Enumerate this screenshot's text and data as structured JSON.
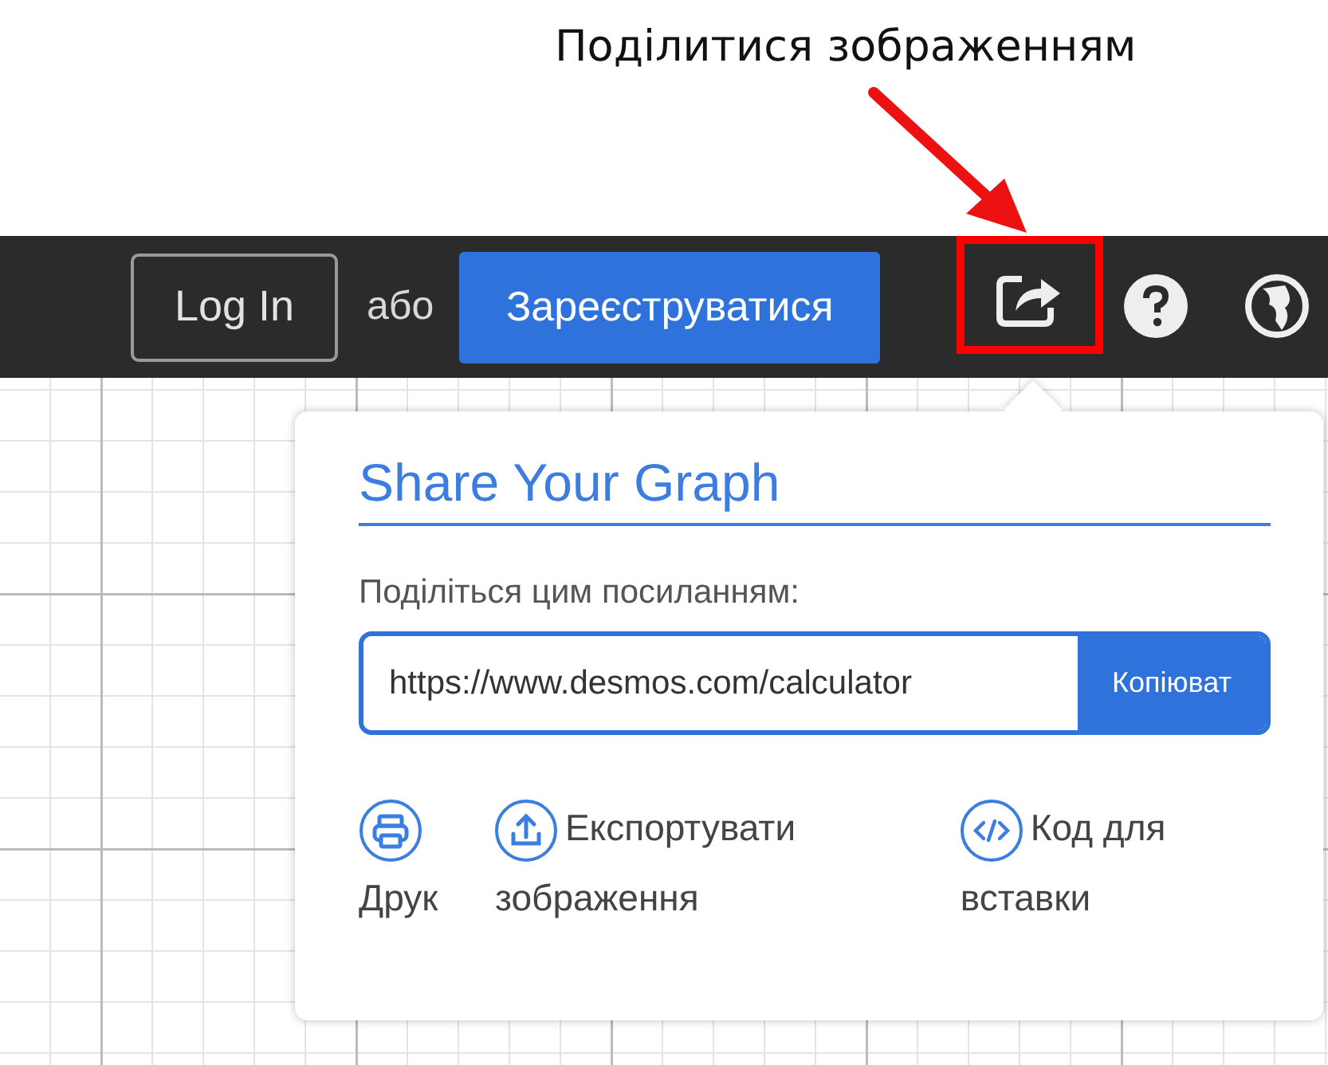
{
  "annotation": {
    "text": "Поділитися зображенням"
  },
  "toolbar": {
    "login_button": "Log In",
    "or_text": "або",
    "signup_button": "Зареєструватися"
  },
  "share_popover": {
    "title": "Share Your Graph",
    "link_label": "Поділіться цим посиланням:",
    "link_value": "https://www.desmos.com/calculator",
    "copy_button": "Копіюват",
    "actions": [
      {
        "kind": "print",
        "label": "Друк"
      },
      {
        "kind": "export",
        "label": "Експортувати зображення"
      },
      {
        "kind": "embed",
        "label": "Код для вставки"
      }
    ]
  }
}
